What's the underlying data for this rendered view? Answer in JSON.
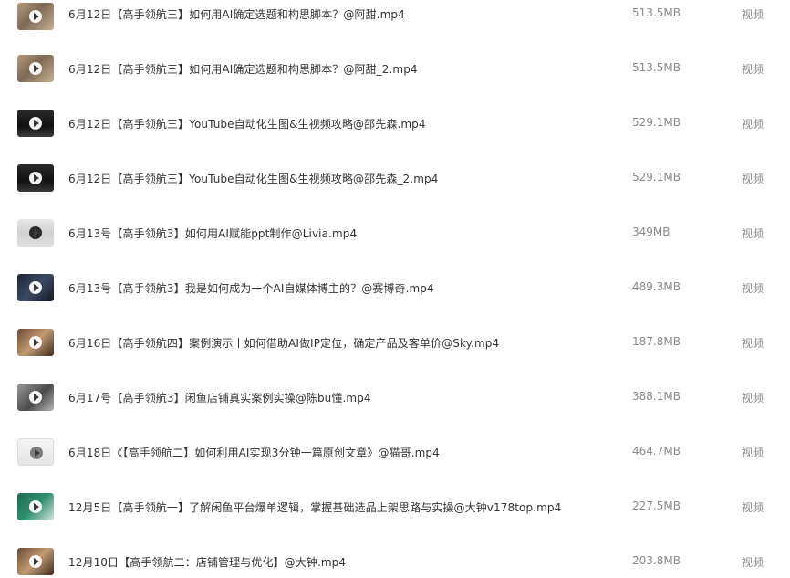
{
  "files": [
    {
      "name": "6月12日【高手领航三】如何用AI确定选题和构思脚本？@阿甜.mp4",
      "size": "513.5MB",
      "type": "视频",
      "thumb": "person-video"
    },
    {
      "name": "6月12日【高手领航三】如何用AI确定选题和构思脚本？@阿甜_2.mp4",
      "size": "513.5MB",
      "type": "视频",
      "thumb": "person-video"
    },
    {
      "name": "6月12日【高手领航三】YouTube自动化生图&生视频攻略@邵先森.mp4",
      "size": "529.1MB",
      "type": "视频",
      "thumb": "dark-screen"
    },
    {
      "name": "6月12日【高手领航三】YouTube自动化生图&生视频攻略@邵先森_2.mp4",
      "size": "529.1MB",
      "type": "视频",
      "thumb": "dark-screen"
    },
    {
      "name": "6月13号【高手领航3】如何用AI赋能ppt制作@Livia.mp4",
      "size": "349MB",
      "type": "视频",
      "thumb": "light-person"
    },
    {
      "name": "6月13号【高手领航3】我是如何成为一个AI自媒体博主的？@赛博奇.mp4",
      "size": "489.3MB",
      "type": "视频",
      "thumb": "dark-grid"
    },
    {
      "name": "6月16日【高手领航四】案例演示丨如何借助AI做IP定位，确定产品及客单价@Sky.mp4",
      "size": "187.8MB",
      "type": "视频",
      "thumb": "warm-person"
    },
    {
      "name": "6月17号【高手领航3】闲鱼店铺真实案例实操@陈bu懂.mp4",
      "size": "388.1MB",
      "type": "视频",
      "thumb": "gray-person"
    },
    {
      "name": "6月18日《【高手领航二】如何利用AI实现3分钟一篇原创文章》@猫哥.mp4",
      "size": "464.7MB",
      "type": "视频",
      "thumb": "light-screen"
    },
    {
      "name": "12月5日【高手领航一】了解闲鱼平台爆单逻辑，掌握基础选品上架思路与实操@大钟v178top.mp4",
      "size": "227.5MB",
      "type": "视频",
      "thumb": "green-screen"
    },
    {
      "name": "12月10日【高手领航二：店铺管理与优化】@大钟.mp4",
      "size": "203.8MB",
      "type": "视频",
      "thumb": "warm-person"
    }
  ]
}
